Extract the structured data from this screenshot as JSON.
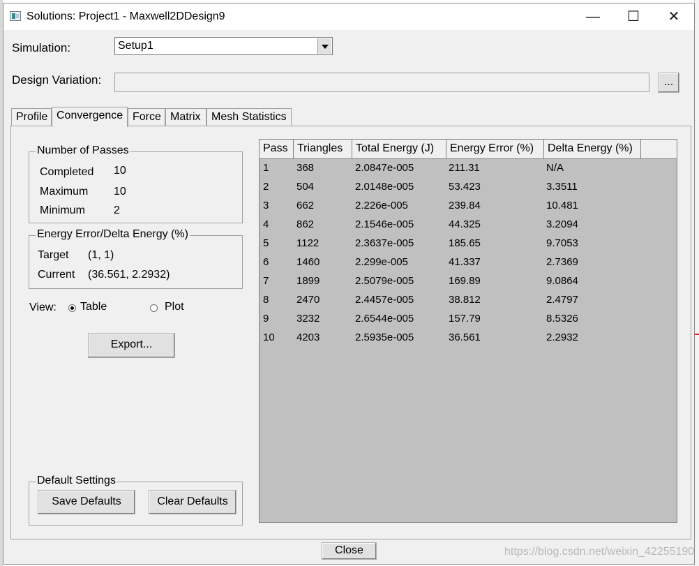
{
  "window": {
    "title": "Solutions: Project1 - Maxwell2DDesign9"
  },
  "titlebar_controls": {
    "minimize": "—",
    "maximize": "☐",
    "close": "✕"
  },
  "simulation": {
    "label": "Simulation:",
    "value": "Setup1"
  },
  "design_variation": {
    "label": "Design Variation:",
    "value": "",
    "browse_label": "..."
  },
  "tabs": [
    {
      "label": "Profile"
    },
    {
      "label": "Convergence"
    },
    {
      "label": "Force"
    },
    {
      "label": "Matrix"
    },
    {
      "label": "Mesh Statistics"
    }
  ],
  "active_tab": "Convergence",
  "passes": {
    "title": "Number of Passes",
    "completed_label": "Completed",
    "completed": "10",
    "maximum_label": "Maximum",
    "maximum": "10",
    "minimum_label": "Minimum",
    "minimum": "2"
  },
  "energy": {
    "title": "Energy Error/Delta Energy (%)",
    "target_label": "Target",
    "target": "(1, 1)",
    "current_label": "Current",
    "current": "(36.561, 2.2932)"
  },
  "view": {
    "label": "View:",
    "table_label": "Table",
    "plot_label": "Plot",
    "selected": "Table"
  },
  "export_label": "Export...",
  "defaults": {
    "title": "Default Settings",
    "save_label": "Save Defaults",
    "clear_label": "Clear Defaults"
  },
  "table": {
    "columns": [
      "Pass",
      "Triangles",
      "Total Energy (J)",
      "Energy Error (%)",
      "Delta Energy (%)"
    ],
    "rows": [
      [
        "1",
        "368",
        "2.0847e-005",
        "211.31",
        "N/A"
      ],
      [
        "2",
        "504",
        "2.0148e-005",
        "53.423",
        "3.3511"
      ],
      [
        "3",
        "662",
        "2.226e-005",
        "239.84",
        "10.481"
      ],
      [
        "4",
        "862",
        "2.1546e-005",
        "44.325",
        "3.2094"
      ],
      [
        "5",
        "1122",
        "2.3637e-005",
        "185.65",
        "9.7053"
      ],
      [
        "6",
        "1460",
        "2.299e-005",
        "41.337",
        "2.7369"
      ],
      [
        "7",
        "1899",
        "2.5079e-005",
        "169.89",
        "9.0864"
      ],
      [
        "8",
        "2470",
        "2.4457e-005",
        "38.812",
        "2.4797"
      ],
      [
        "9",
        "3232",
        "2.6544e-005",
        "157.79",
        "8.5326"
      ],
      [
        "10",
        "4203",
        "2.5935e-005",
        "36.561",
        "2.2932"
      ]
    ]
  },
  "close_label": "Close",
  "watermark": "https://blog.csdn.net/weixin_42255190"
}
